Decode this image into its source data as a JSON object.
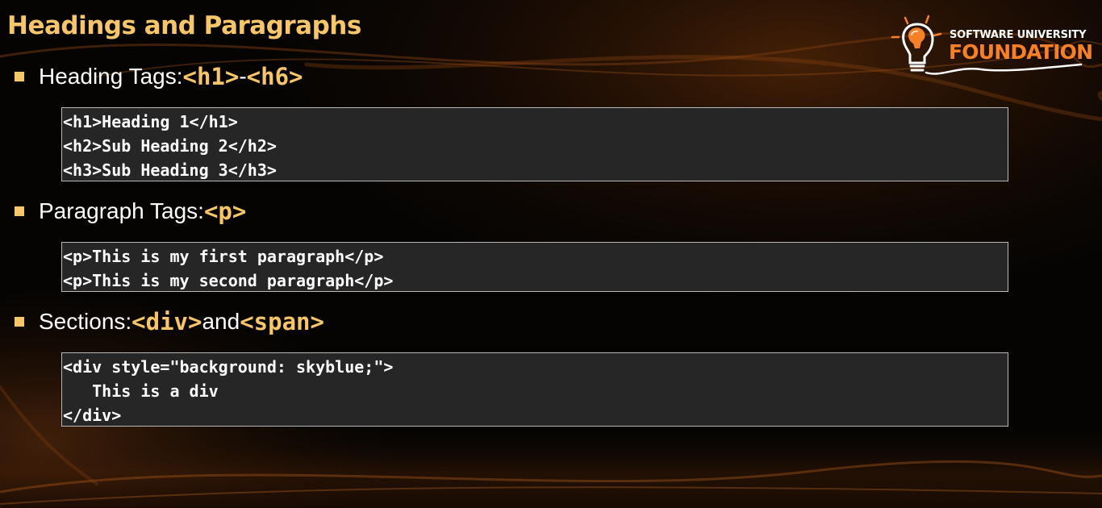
{
  "slide": {
    "title": "Headings and Paragraphs"
  },
  "logo": {
    "line1": "SOFTWARE UNIVERSITY",
    "line2": "FOUNDATION",
    "icon": "lightbulb-head-icon"
  },
  "bullets": [
    {
      "label": "Heading Tags: ",
      "tag1": "<h1>",
      "connector": " - ",
      "tag2": "<h6>"
    },
    {
      "label": "Paragraph Tags: ",
      "tag1": "<p>"
    },
    {
      "label": "Sections: ",
      "tag1": "<div>",
      "connector": " and ",
      "tag2": "<span>"
    }
  ],
  "code_blocks": [
    {
      "lines": [
        "<h1>Heading 1</h1>",
        "<h2>Sub Heading 2</h2>",
        "<h3>Sub Heading 3</h3>"
      ]
    },
    {
      "lines": [
        "<p>This is my first paragraph</p>",
        "<p>This is my second paragraph</p>"
      ]
    },
    {
      "lines": [
        "<div style=\"background: skyblue;\">",
        "   This is a div",
        "</div>"
      ]
    }
  ],
  "colors": {
    "accent": "#f7c56a",
    "logo_orange": "#f58025",
    "background": "#050403",
    "code_background": "#262626",
    "code_border": "#b8b8b8",
    "text": "#ffffff"
  }
}
